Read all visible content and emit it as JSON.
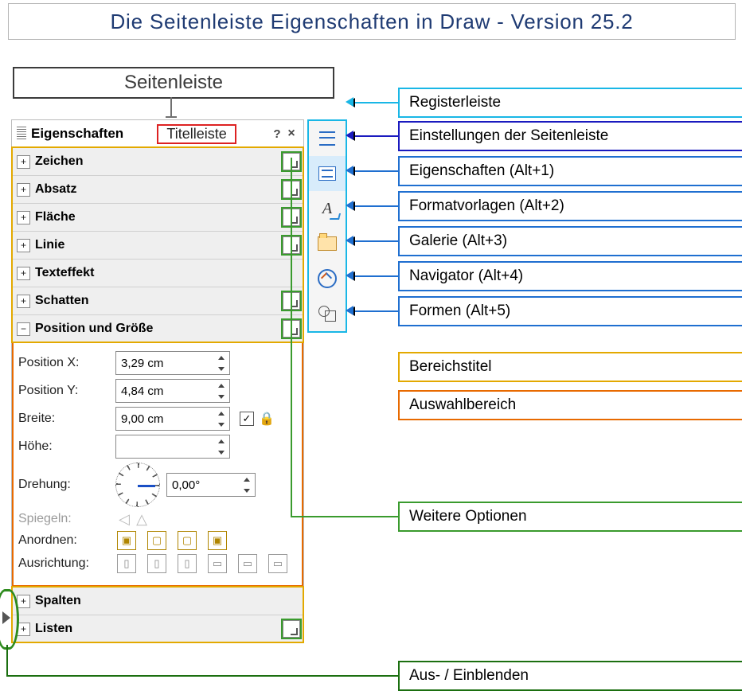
{
  "title": "Die Seitenleiste Eigenschaften in Draw - Version 25.2",
  "sidebar_label": "Seitenleiste",
  "panel": {
    "title": "Eigenschaften",
    "title_label_box": "Titelleiste",
    "help": "?",
    "close": "×",
    "sections": [
      {
        "expander": "+",
        "label": "Zeichen",
        "more": true
      },
      {
        "expander": "+",
        "label": "Absatz",
        "more": true
      },
      {
        "expander": "+",
        "label": "Fläche",
        "more": true
      },
      {
        "expander": "+",
        "label": "Linie",
        "more": true
      },
      {
        "expander": "+",
        "label": "Texteffekt",
        "more": false
      },
      {
        "expander": "+",
        "label": "Schatten",
        "more": true
      },
      {
        "expander": "−",
        "label": "Position und Größe",
        "more": true
      }
    ],
    "pos": {
      "px_label": "Position X:",
      "px_value": "3,29 cm",
      "py_label": "Position Y:",
      "py_value": "4,84 cm",
      "w_label": "Breite:",
      "w_value": "9,00 cm",
      "h_label": "Höhe:",
      "h_value": "",
      "rot_label": "Drehung:",
      "rot_value": "0,00°",
      "mirror_label": "Spiegeln:",
      "arrange_label": "Anordnen:",
      "align_label": "Ausrichtung:"
    },
    "bottom": [
      {
        "expander": "+",
        "label": "Spalten",
        "more": false
      },
      {
        "expander": "+",
        "label": "Listen",
        "more": true
      }
    ]
  },
  "callouts": {
    "register": "Registerleiste",
    "settings": "Einstellungen der Seitenleiste",
    "props": "Eigenschaften (Alt+1)",
    "styles": "Formatvorlagen (Alt+2)",
    "gallery": "Galerie (Alt+3)",
    "nav": "Navigator (Alt+4)",
    "shapes": "Formen (Alt+5)",
    "section_title": "Bereichstitel",
    "selection": "Auswahlbereich",
    "more": "Weitere Optionen",
    "hideshow": "Aus- / Einblenden"
  },
  "colors": {
    "cyan": "#19b7e6",
    "navy": "#1a1abf",
    "blue": "#1f6fd0",
    "yellow": "#e3a900",
    "orange": "#e86a00",
    "green": "#3a9b2e",
    "darkgreen": "#1b6f10"
  }
}
